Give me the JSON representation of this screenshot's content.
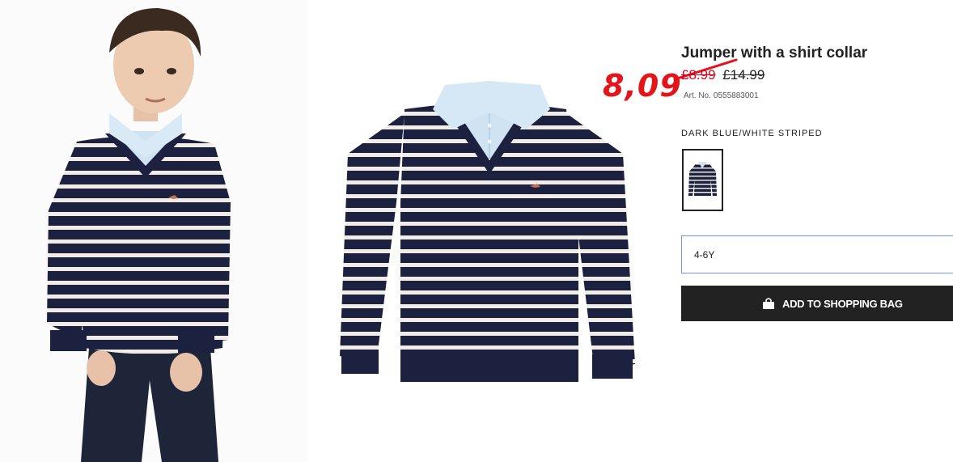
{
  "product": {
    "title": "Jumper with a shirt collar",
    "sale_price": "£8.99",
    "old_price": "£14.99",
    "art_label": "Art. No.",
    "art_number": "0555883001",
    "handwritten_price": "8,09"
  },
  "color": {
    "label": "DARK BLUE/WHITE STRIPED"
  },
  "size": {
    "selected": "4-6Y"
  },
  "actions": {
    "add_to_bag_label": "ADD TO SHOPPING BAG"
  },
  "colors": {
    "sale_red": "#d6001c",
    "annotation_red": "#e4141b",
    "button_bg": "#222222",
    "select_border": "#6f96e8",
    "navy": "#1d2140",
    "stripe": "#f2ece6",
    "shirt": "#cfe3f3"
  },
  "icons": {
    "bag": "shopping-bag-icon"
  }
}
